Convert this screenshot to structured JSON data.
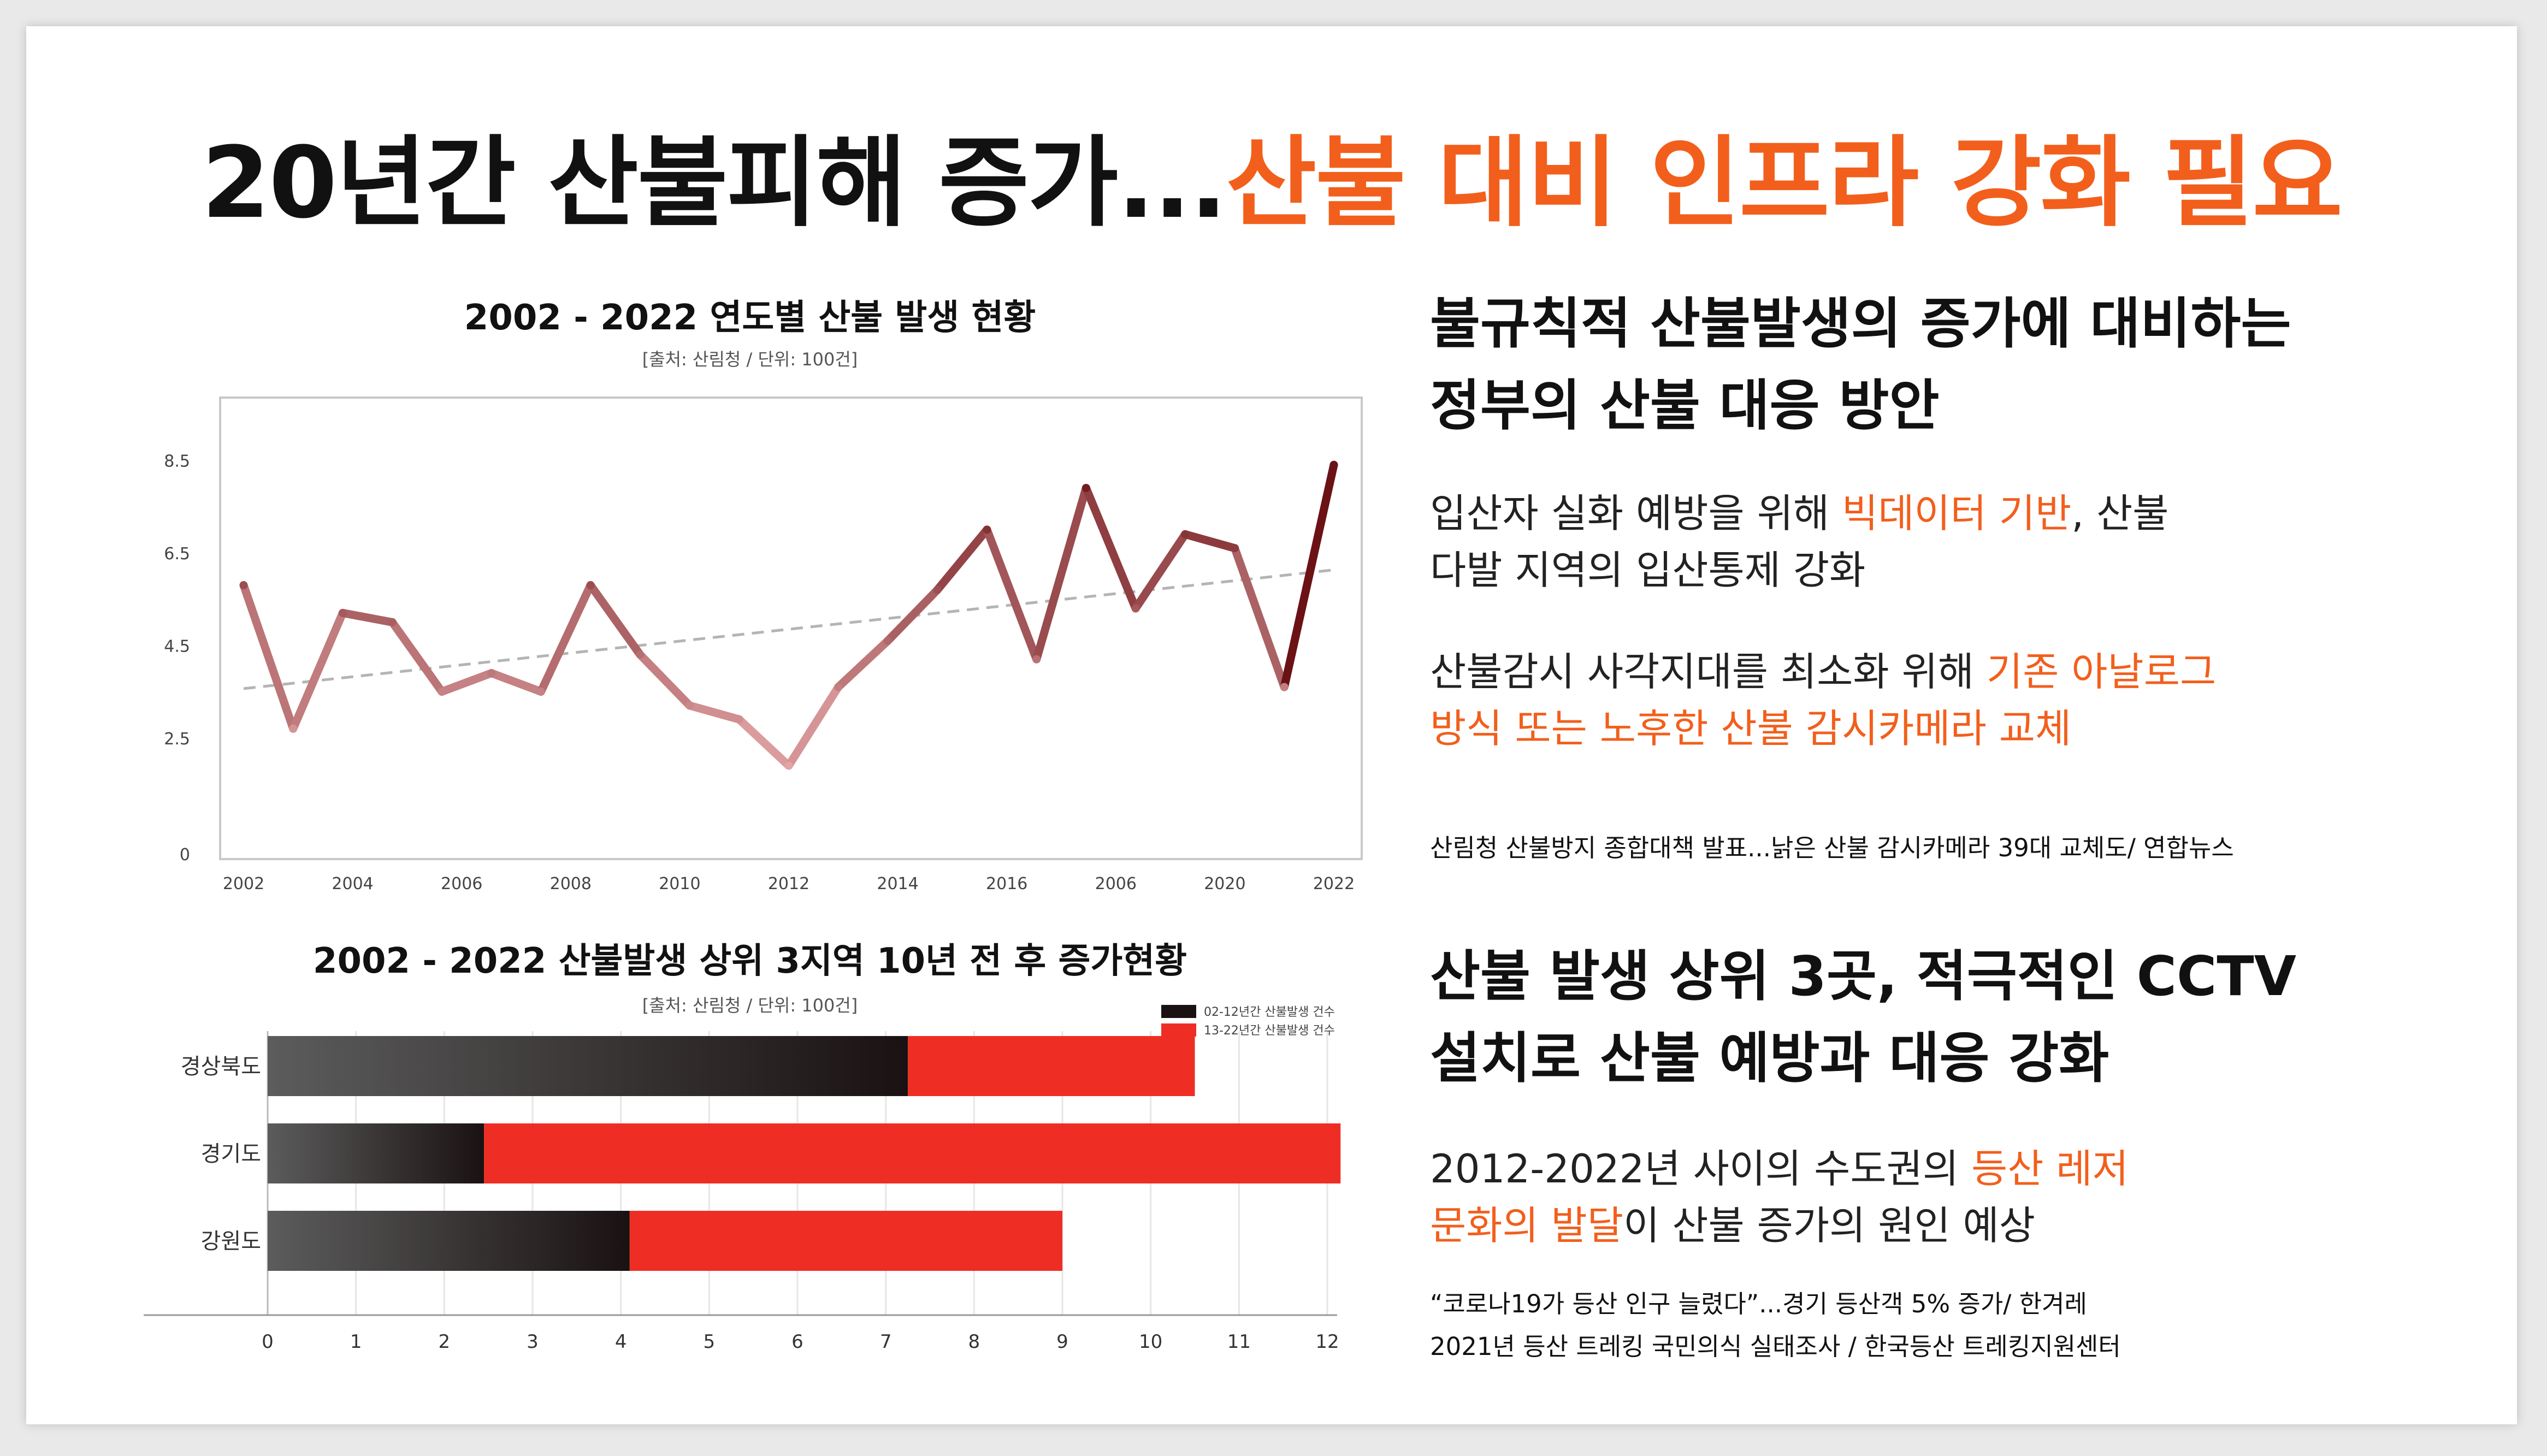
{
  "title": {
    "part1": "20년간 산불피해 증가...",
    "part2": "산불 대비 인프라 강화 필요"
  },
  "colors": {
    "accent": "#f25f1c",
    "line_start": "#c85a5e",
    "line_end": "#6b1216",
    "bar_red": "#ee2e24",
    "bar_dark": "#1a1212",
    "trend": "#b4b4b4"
  },
  "charts": [
    {
      "title": "2002 - 2022 연도별 산불 발생 현황",
      "subtitle": "[출처: 산림청 / 단위: 100건]",
      "chart_data": {
        "type": "line",
        "x": [
          2002,
          2003,
          2004,
          2005,
          2006,
          2007,
          2008,
          2009,
          2010,
          2011,
          2012,
          2013,
          2014,
          2015,
          2016,
          2017,
          2018,
          2019,
          2020,
          2021,
          2022
        ],
        "series": [
          {
            "values": [
              5.8,
              2.7,
              5.2,
              5.0,
              3.5,
              3.9,
              3.5,
              5.8,
              4.3,
              3.2,
              2.9,
              1.9,
              3.6,
              4.6,
              5.7,
              7.0,
              4.2,
              7.9,
              5.3,
              6.9,
              6.6,
              3.6,
              8.4
            ]
          }
        ],
        "trendline": true,
        "ylim": [
          0,
          9.5
        ],
        "yticks": [
          "0",
          "2.5",
          "4.5",
          "6.5",
          "8.5"
        ],
        "xticks": [
          "2002",
          "2004",
          "2006",
          "2008",
          "2010",
          "2012",
          "2014",
          "2016",
          "2006",
          "2020",
          "2022"
        ],
        "xlabel": "",
        "ylabel": "",
        "grid": false
      }
    },
    {
      "title": "2002 - 2022 산불발생 상위 3지역 10년 전 후 증가현황",
      "subtitle": "[출처: 산림청 / 단위: 100건]",
      "chart_data": {
        "type": "bar",
        "orientation": "horizontal",
        "stacked": true,
        "categories": [
          "경상북도",
          "경기도",
          "강원도"
        ],
        "series": [
          {
            "name": "02-12년간 산불발생 건수",
            "values": [
              7.25,
              2.45,
              4.1
            ]
          },
          {
            "name": "13-22년간 산불발생 건수",
            "values": [
              3.25,
              9.7,
              4.9
            ]
          }
        ],
        "xlim": [
          0,
          12.5
        ],
        "xticks": [
          "0",
          "1",
          "2",
          "3",
          "4",
          "5",
          "6",
          "7",
          "8",
          "9",
          "10",
          "11",
          "12"
        ],
        "legend": "top-right",
        "grid": true
      }
    }
  ],
  "right": {
    "section1": {
      "heading_line1": "불규칙적 산불발생의 증가에 대비하는",
      "heading_line2": "정부의 산불 대응 방안",
      "p1": {
        "a": "입산자 실화 예방을 위해 ",
        "b": "빅데이터 기반",
        "c": ", 산불",
        "d": "다발 지역의 입산통제 강화"
      },
      "p2": {
        "a": "산불감시 사각지대를 최소화 위해 ",
        "b": "기존 아날로그",
        "c": "방식 또는 노후한 산불 감시카메라 교체"
      },
      "source": "산림청 산불방지 종합대책 발표...낡은 산불 감시카메라 39대 교체도/ 연합뉴스"
    },
    "section2": {
      "heading_line1": "산불 발생 상위 3곳, 적극적인 CCTV",
      "heading_line2": "설치로 산불 예방과 대응 강화",
      "p1": {
        "a": "2012-2022년 사이의 수도권의 ",
        "b": "등산 레저",
        "c": "문화의 발달",
        "d": "이 산불 증가의 원인 예상"
      },
      "source1": "“코로나19가 등산 인구 늘렸다”...경기 등산객 5% 증가/ 한겨레",
      "source2": "2021년 등산 트레킹 국민의식 실태조사 / 한국등산 트레킹지원센터"
    }
  }
}
